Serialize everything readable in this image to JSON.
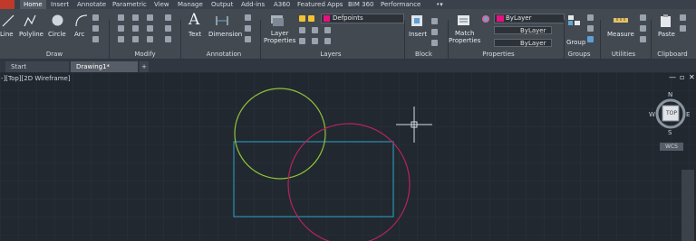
{
  "tabs": [
    "Home",
    "Insert",
    "Annotate",
    "Parametric",
    "View",
    "Manage",
    "Output",
    "Add-ins",
    "A360",
    "Featured Apps",
    "BIM 360",
    "Performance"
  ],
  "draw_tools": [
    "Line",
    "Polyline",
    "Circle",
    "Arc"
  ],
  "panels": [
    "Draw",
    "Modify",
    "Annotation",
    "Layers",
    "Block",
    "Properties",
    "Groups",
    "Utilities",
    "Clipboard"
  ],
  "annotation_tools": [
    "Text",
    "Dimension"
  ],
  "layer_tools": {
    "layer_properties": "Layer\nProperties",
    "layer_name": "Defpoints"
  },
  "block_tools": {
    "insert": "Insert"
  },
  "properties": {
    "match": "Match\nProperties",
    "color": "ByLayer",
    "linetype": "ByLayer",
    "lineweight": "ByLayer"
  },
  "group_tools": {
    "group": "Group"
  },
  "utility_tools": {
    "measure": "Measure"
  },
  "clipboard_tools": {
    "paste": "Paste"
  },
  "file_tabs": [
    "Start",
    "Drawing1*"
  ],
  "viewport_label": "-][Top][2D Wireframe]",
  "viewcube": {
    "n": "N",
    "s": "S",
    "e": "E",
    "w": "W",
    "top": "TOP",
    "wcs": "WCS"
  },
  "colors": {
    "circle_green": "#8fc33a",
    "circle_magenta": "#b8245b",
    "rectangle": "#2f8fb0",
    "layer_swatch": "#e8117f"
  }
}
